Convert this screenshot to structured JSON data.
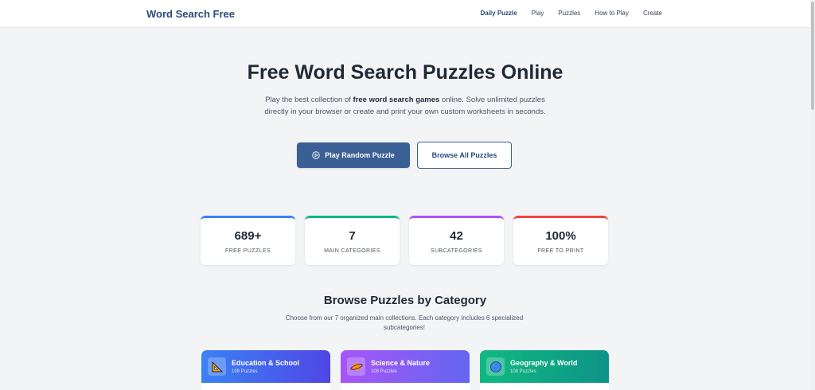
{
  "header": {
    "brand": "Word Search Free",
    "nav": [
      "Daily Puzzle",
      "Play",
      "Puzzles",
      "How to Play",
      "Create"
    ]
  },
  "hero": {
    "title": "Free Word Search Puzzles Online",
    "desc_pre": "Play the best collection of ",
    "desc_bold": "free word search games",
    "desc_post": " online. Solve unlimited puzzles directly in your browser or create and print your own custom worksheets in seconds.",
    "primary_button": "Play Random Puzzle",
    "secondary_button": "Browse All Puzzles"
  },
  "stats": [
    {
      "value": "689+",
      "label": "FREE PUZZLES",
      "color": "#3b82f6"
    },
    {
      "value": "7",
      "label": "MAIN CATEGORIES",
      "color": "#10b981"
    },
    {
      "value": "42",
      "label": "SUBCATEGORIES",
      "color": "#a855f7"
    },
    {
      "value": "100%",
      "label": "FREE TO PRINT",
      "color": "#ef4444"
    }
  ],
  "categories_section": {
    "title": "Browse Puzzles by Category",
    "desc": "Choose from our 7 organized main collections. Each category includes 6 specialized subcategories!",
    "cards": [
      {
        "name": "Education & School",
        "count": "108 Puzzles",
        "icon": "ruler-triangle-icon"
      },
      {
        "name": "Science & Nature",
        "count": "108 Puzzles",
        "icon": "planet-icon"
      },
      {
        "name": "Geography & World",
        "count": "108 Puzzles",
        "icon": "globe-icon"
      }
    ]
  }
}
